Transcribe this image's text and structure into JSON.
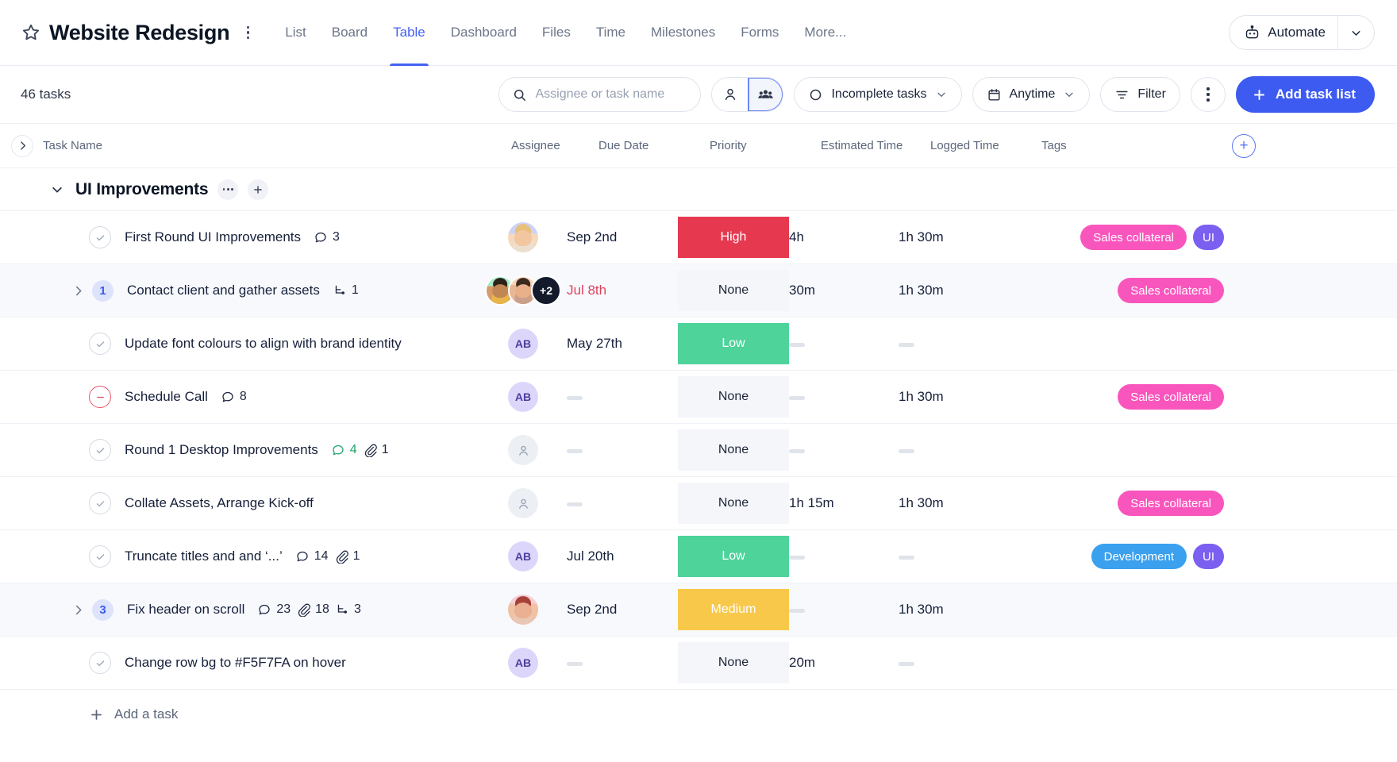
{
  "header": {
    "star_icon": "star-outline-icon",
    "project_title": "Website Redesign",
    "kebab_icon": "kebab-vertical-icon",
    "tabs": [
      {
        "label": "List",
        "active": false
      },
      {
        "label": "Board",
        "active": false
      },
      {
        "label": "Table",
        "active": true
      },
      {
        "label": "Dashboard",
        "active": false
      },
      {
        "label": "Files",
        "active": false
      },
      {
        "label": "Time",
        "active": false
      },
      {
        "label": "Milestones",
        "active": false
      },
      {
        "label": "Forms",
        "active": false
      },
      {
        "label": "More...",
        "active": false
      }
    ],
    "automate": {
      "label": "Automate",
      "icon": "robot-icon",
      "caret_icon": "chevron-down-icon"
    }
  },
  "toolbar": {
    "task_count": "46 tasks",
    "search": {
      "placeholder": "Assignee or task name",
      "value": "",
      "icon": "search-icon"
    },
    "view_toggle": {
      "person_icon": "person-icon",
      "people_icon": "people-group-icon",
      "selected": "people-group"
    },
    "status_filter": {
      "label": "Incomplete tasks",
      "icon": "circle-icon",
      "caret_icon": "chevron-down-icon"
    },
    "date_filter": {
      "label": "Anytime",
      "icon": "calendar-icon",
      "caret_icon": "chevron-down-icon"
    },
    "filter": {
      "label": "Filter",
      "icon": "filter-lines-icon"
    },
    "more_icon": "kebab-vertical-icon",
    "add_task_list": {
      "label": "Add task list",
      "icon": "plus-icon"
    }
  },
  "table": {
    "collapse_all_icon": "chevron-right-icon",
    "add_column_icon": "plus-circle-icon",
    "columns": [
      "Task Name",
      "Assignee",
      "Due Date",
      "Priority",
      "Estimated Time",
      "Logged Time",
      "Tags"
    ]
  },
  "group": {
    "caret_icon": "chevron-down-icon",
    "title": "UI Improvements",
    "options_icon": "ellipsis-icon",
    "add_icon": "plus-icon"
  },
  "rows": [
    {
      "status": "complete",
      "expander": null,
      "subcount": null,
      "title": "First Round UI Improvements",
      "comments": "3",
      "comments_unread": false,
      "attachments": null,
      "subtasks": null,
      "assignee_type": "photo-single",
      "assignee_faces": [
        "f-blonde"
      ],
      "assignee_extra": null,
      "due": "Sep 2nd",
      "due_overdue": false,
      "priority": "High",
      "priority_level": "high",
      "estimated": "4h",
      "logged": "1h 30m",
      "tags": [
        {
          "label": "Sales collateral",
          "style": "sales"
        },
        {
          "label": "UI",
          "style": "ui"
        }
      ],
      "tinted": false
    },
    {
      "status": "expandable",
      "expander": "chevron-right-icon",
      "subcount": "1",
      "title": "Contact client and gather assets",
      "comments": null,
      "comments_unread": false,
      "attachments": null,
      "subtasks": "1",
      "assignee_type": "photo-stack",
      "assignee_faces": [
        "f-green",
        "f-peach"
      ],
      "assignee_extra": "+2",
      "due": "Jul 8th",
      "due_overdue": true,
      "priority": "None",
      "priority_level": "none",
      "estimated": "30m",
      "logged": "1h 30m",
      "tags": [
        {
          "label": "Sales collateral",
          "style": "sales"
        }
      ],
      "tinted": true
    },
    {
      "status": "complete",
      "expander": null,
      "subcount": null,
      "title": "Update font colours to align with brand identity",
      "comments": null,
      "comments_unread": false,
      "attachments": null,
      "subtasks": null,
      "assignee_type": "initials",
      "assignee_initials": "AB",
      "due": "May 27th",
      "due_overdue": false,
      "priority": "Low",
      "priority_level": "low",
      "estimated": "—",
      "logged": "—",
      "tags": [],
      "tinted": false
    },
    {
      "status": "blocked",
      "expander": null,
      "subcount": null,
      "title": "Schedule Call",
      "comments": "8",
      "comments_unread": false,
      "attachments": null,
      "subtasks": null,
      "assignee_type": "initials",
      "assignee_initials": "AB",
      "due": "—",
      "due_overdue": false,
      "priority": "None",
      "priority_level": "none",
      "estimated": "—",
      "logged": "1h 30m",
      "tags": [
        {
          "label": "Sales collateral",
          "style": "sales"
        }
      ],
      "tinted": false
    },
    {
      "status": "complete",
      "expander": null,
      "subcount": null,
      "title": "Round 1 Desktop Improvements",
      "comments": "4",
      "comments_unread": true,
      "attachments": "1",
      "subtasks": null,
      "assignee_type": "empty",
      "due": "—",
      "due_overdue": false,
      "priority": "None",
      "priority_level": "none",
      "estimated": "—",
      "logged": "—",
      "tags": [],
      "tinted": false
    },
    {
      "status": "complete",
      "expander": null,
      "subcount": null,
      "title": "Collate Assets, Arrange Kick-off",
      "comments": null,
      "comments_unread": false,
      "attachments": null,
      "subtasks": null,
      "assignee_type": "empty",
      "due": "—",
      "due_overdue": false,
      "priority": "None",
      "priority_level": "none",
      "estimated": "1h 15m",
      "logged": "1h 30m",
      "tags": [
        {
          "label": "Sales collateral",
          "style": "sales"
        }
      ],
      "tinted": false
    },
    {
      "status": "complete",
      "expander": null,
      "subcount": null,
      "title": "Truncate titles and and ‘...’",
      "comments": "14",
      "comments_unread": false,
      "attachments": "1",
      "subtasks": null,
      "assignee_type": "initials",
      "assignee_initials": "AB",
      "due": "Jul 20th",
      "due_overdue": false,
      "priority": "Low",
      "priority_level": "low",
      "estimated": "—",
      "logged": "—",
      "tags": [
        {
          "label": "Development",
          "style": "dev"
        },
        {
          "label": "UI",
          "style": "ui"
        }
      ],
      "tinted": false
    },
    {
      "status": "expandable",
      "expander": "chevron-right-icon",
      "subcount": "3",
      "title": "Fix header on scroll",
      "comments": "23",
      "comments_unread": false,
      "attachments": "18",
      "subtasks": "3",
      "assignee_type": "photo-single",
      "assignee_faces": [
        "f-red"
      ],
      "assignee_extra": null,
      "due": "Sep 2nd",
      "due_overdue": false,
      "priority": "Medium",
      "priority_level": "medium",
      "estimated": "—",
      "logged": "1h 30m",
      "tags": [],
      "tinted": true
    },
    {
      "status": "complete",
      "expander": null,
      "subcount": null,
      "title": "Change row bg to #F5F7FA on hover",
      "comments": null,
      "comments_unread": false,
      "attachments": null,
      "subtasks": null,
      "assignee_type": "initials",
      "assignee_initials": "AB",
      "due": "—",
      "due_overdue": false,
      "priority": "None",
      "priority_level": "none",
      "estimated": "20m",
      "logged": "—",
      "tags": [],
      "tinted": false
    }
  ],
  "footer": {
    "add_task_label": "Add a task",
    "add_task_icon": "plus-icon"
  },
  "colors": {
    "accent": "#3d5bf0",
    "tab_active": "#4461f2",
    "priority_high": "#e63950",
    "priority_medium": "#f8c84a",
    "priority_low": "#4ed39b",
    "priority_none_bg": "#f4f6fa",
    "tag_sales": "#f956bd",
    "tag_development": "#3ba0ee",
    "tag_ui": "#7b5ff0",
    "overdue": "#e0425c",
    "unread_comment": "#22a36b"
  }
}
